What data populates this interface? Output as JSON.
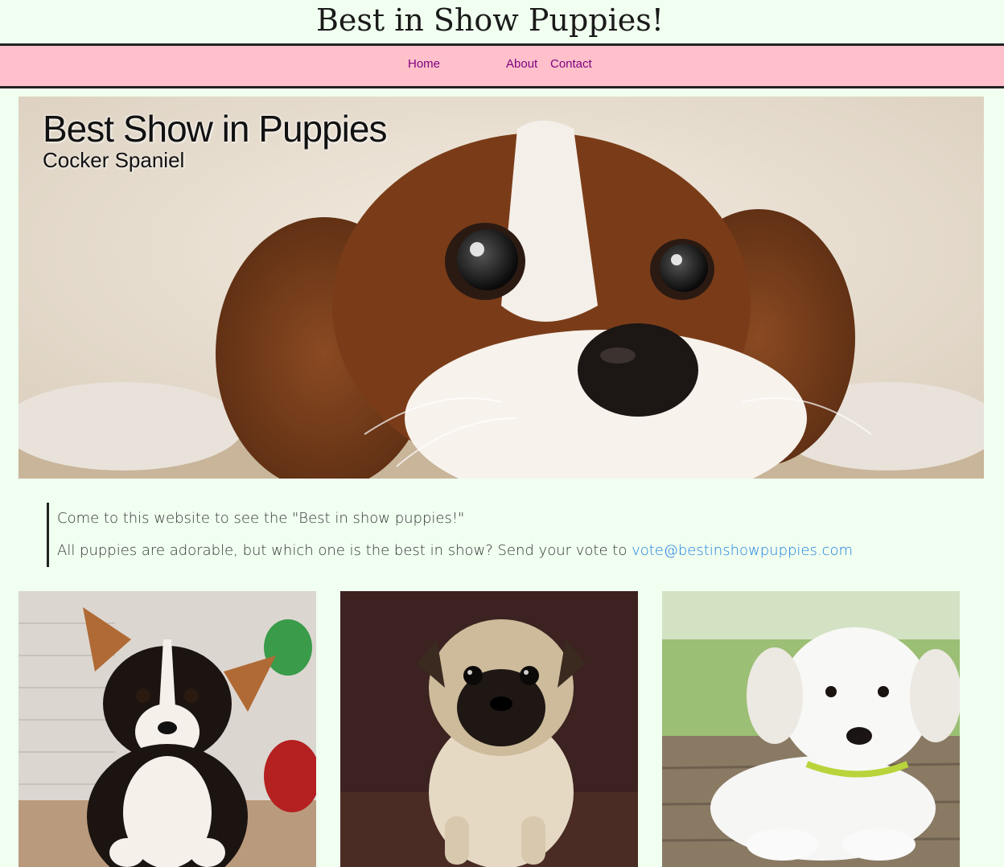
{
  "site": {
    "title": "Best in Show Puppies!"
  },
  "nav": {
    "home": "Home",
    "about": "About",
    "contact": "Contact"
  },
  "hero": {
    "title": "Best Show in Puppies",
    "subtitle": "Cocker Spaniel",
    "image": "cocker-spaniel-puppy-photo"
  },
  "intro": {
    "line1": "Come to this website to see the \"Best in show puppies!\"",
    "line2_prefix": "All puppies are adorable, but which one is the best in show? Send your vote to ",
    "email": "vote@bestinshowpuppies.com"
  },
  "gallery": [
    {
      "image": "corgi-puppy-photo"
    },
    {
      "image": "pug-puppy-photo"
    },
    {
      "image": "white-labrador-puppy-photo"
    }
  ],
  "colors": {
    "page_background": "#f0fff0",
    "navbar_background": "#ffc0cb",
    "nav_link": "#800080",
    "email_link": "#1e7fe0"
  }
}
